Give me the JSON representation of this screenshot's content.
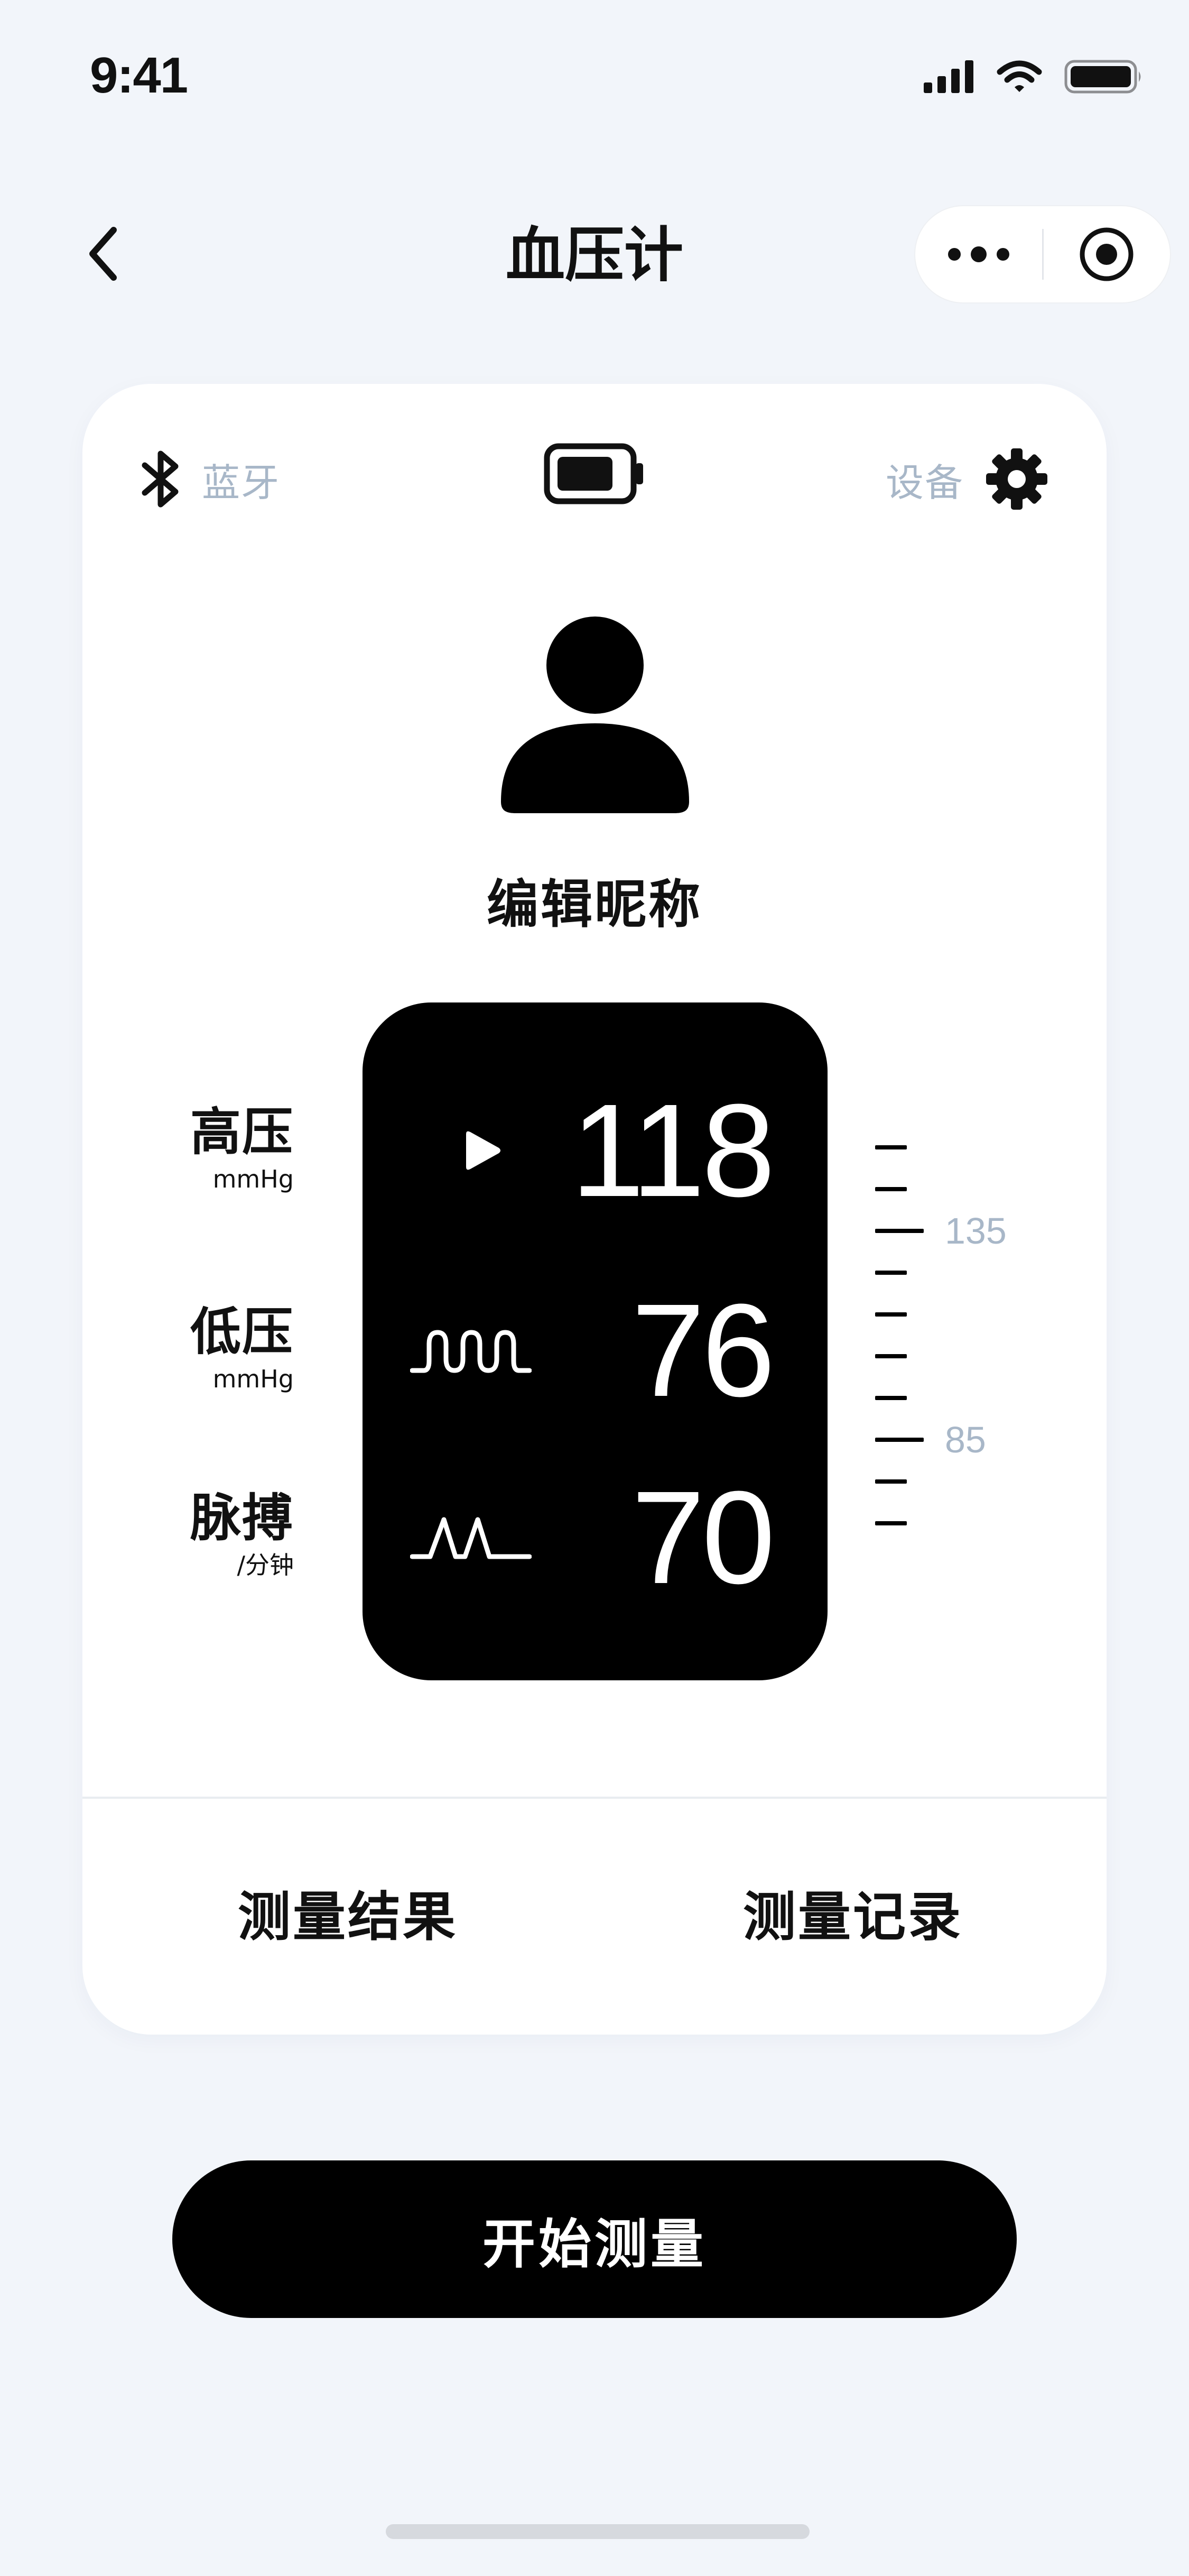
{
  "status_bar": {
    "time": "9:41",
    "icons": [
      "cellular-signal-icon",
      "wifi-icon",
      "battery-icon"
    ]
  },
  "header": {
    "title": "血压计",
    "back_icon": "chevron-left-icon",
    "capsule_icons": [
      "more-dots-icon",
      "target-close-icon"
    ]
  },
  "device_bar": {
    "bluetooth_label": "蓝牙",
    "device_label": "设备",
    "icons": [
      "bluetooth-icon",
      "device-battery-icon",
      "gear-icon"
    ]
  },
  "profile": {
    "avatar_icon": "user-avatar-icon",
    "nickname": "编辑昵称"
  },
  "readings": [
    {
      "label": "高压",
      "unit": "mmHg",
      "value": "118",
      "icon": "play-triangle-icon"
    },
    {
      "label": "低压",
      "unit": "mmHg",
      "value": "76",
      "icon": "square-wave-icon"
    },
    {
      "label": "脉搏",
      "unit": "/分钟",
      "value": "70",
      "icon": "pulse-wave-icon"
    }
  ],
  "scale": {
    "tick_count": 10,
    "labels": [
      {
        "text": "135",
        "tick_index": 2
      },
      {
        "text": "85",
        "tick_index": 7
      }
    ]
  },
  "tabs": {
    "result": "测量结果",
    "history": "测量记录"
  },
  "start_button": "开始测量",
  "colors": {
    "background": "#f2f5fa",
    "card": "#ffffff",
    "panel": "#000000",
    "muted_text": "#a8b7c8",
    "primary_button": "#000000"
  }
}
